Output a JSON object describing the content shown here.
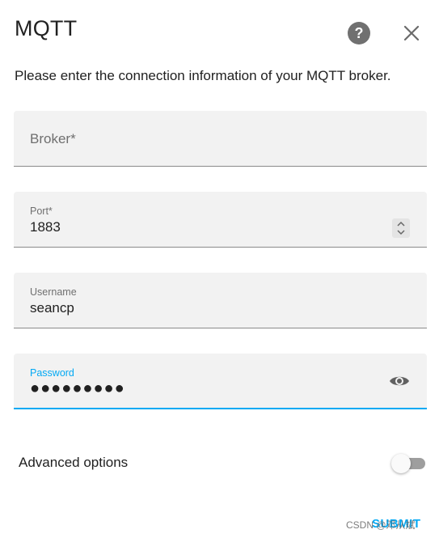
{
  "dialog": {
    "title": "MQTT",
    "help_icon": "help-circle-icon",
    "help_glyph": "?",
    "close_icon": "close-icon",
    "description": "Please enter the connection information of your MQTT broker."
  },
  "fields": {
    "broker": {
      "placeholder": "Broker*",
      "value": ""
    },
    "port": {
      "label": "Port*",
      "value": "1883"
    },
    "username": {
      "label": "Username",
      "value": "seancp"
    },
    "password": {
      "label": "Password",
      "value": "●●●●●●●●●",
      "toggle_icon": "eye-icon"
    }
  },
  "advanced": {
    "label": "Advanced options",
    "enabled": false
  },
  "footer": {
    "submit_label": "SUBMIT"
  },
  "watermark": "CSDN @邓从斌",
  "colors": {
    "accent": "#03a9f4",
    "field_bg": "#f2f2f2",
    "text": "#212121",
    "secondary_text": "#6f6f6f"
  }
}
